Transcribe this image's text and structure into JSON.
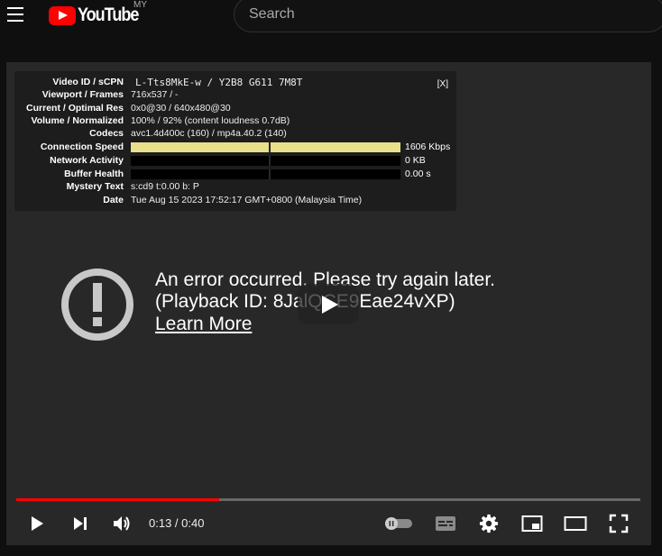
{
  "masthead": {
    "logo_text": "YouTube",
    "country": "MY",
    "search_placeholder": "Search"
  },
  "stats": {
    "close_label": "[X]",
    "rows": [
      {
        "label": "Video ID / sCPN",
        "value": "L-Tts8MkE-w / Y2B8 G611 7M8T"
      },
      {
        "label": "Viewport / Frames",
        "value": "716x537 / -"
      },
      {
        "label": "Current / Optimal Res",
        "value": "0x0@30 / 640x480@30"
      },
      {
        "label": "Volume / Normalized",
        "value": "100% / 92% (content loudness 0.7dB)"
      },
      {
        "label": "Codecs",
        "value": "avc1.4d400c (160) / mp4a.40.2 (140)"
      },
      {
        "label": "Connection Speed",
        "value": "1606 Kbps",
        "fill": 1.0
      },
      {
        "label": "Network Activity",
        "value": "0 KB",
        "fill": 0.0
      },
      {
        "label": "Buffer Health",
        "value": "0.00 s",
        "fill": 0.0
      },
      {
        "label": "Mystery Text",
        "value": "s:cd9 t:0.00 b: P"
      },
      {
        "label": "Date",
        "value": "Tue Aug 15 2023 17:52:17 GMT+0800 (Malaysia Time)"
      }
    ]
  },
  "error": {
    "line1": "An error occurred. Please try again later.",
    "line2": "(Playback ID: 8JalQCE9Eae24vXP)",
    "link": "Learn More"
  },
  "controls": {
    "time": "0:13 / 0:40",
    "progress": 0.325,
    "accent": "#ff0000"
  }
}
